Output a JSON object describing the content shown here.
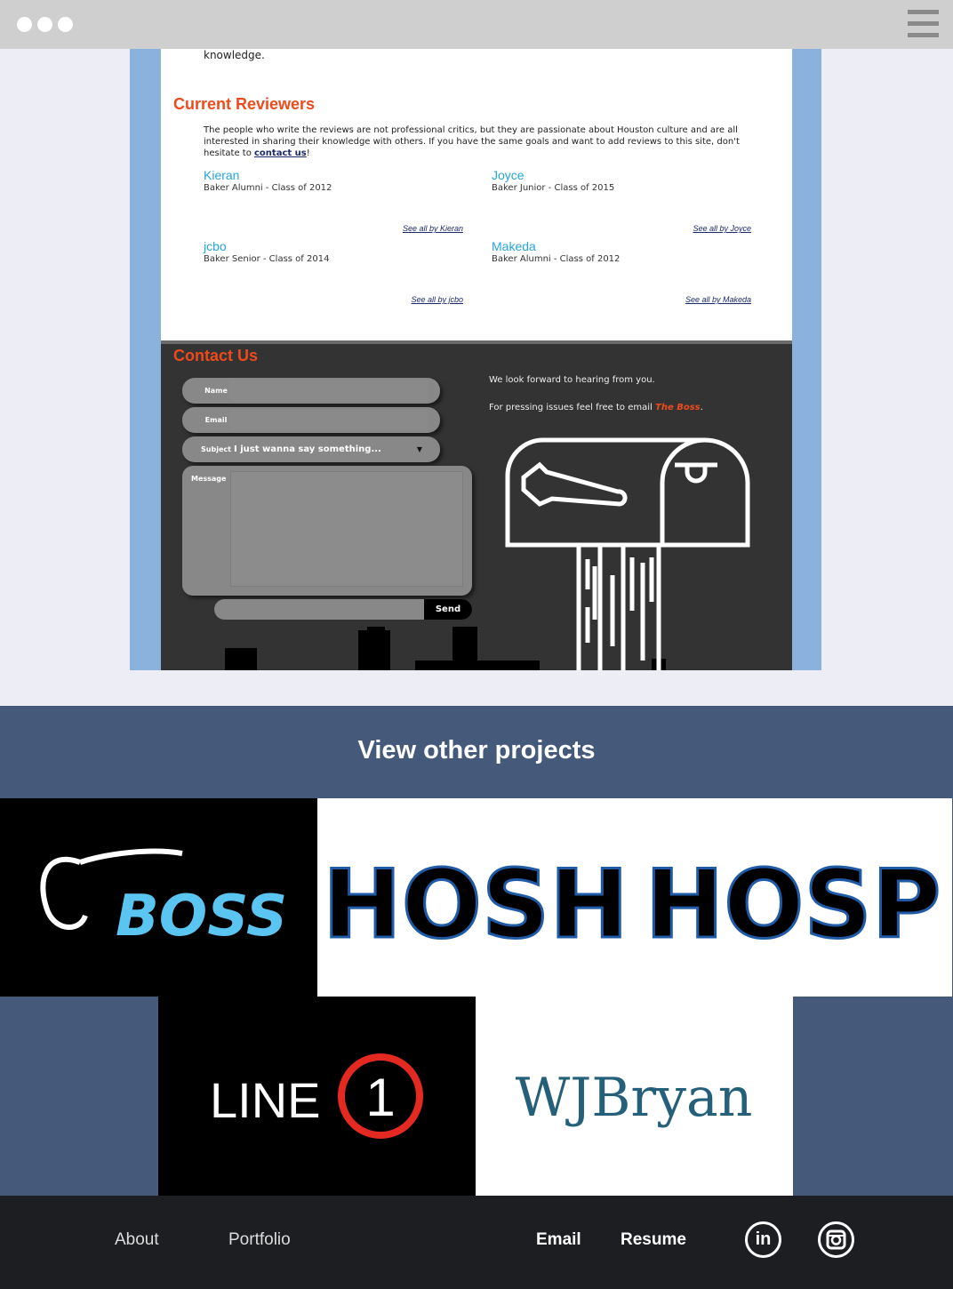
{
  "review_site": {
    "intro_tail": "knowledge.",
    "reviewers_title": "Current Reviewers",
    "reviewers_intro_pre": "The people who write the reviews are not professional critics, but they are passionate about Houston culture and are all interested in sharing their knowledge with others. If you have the same goals and want to add reviews to this site, don't hesitate to ",
    "reviewers_intro_link": "contact us",
    "reviewers_intro_post": "!",
    "reviewers": [
      {
        "name": "Kieran",
        "desc": "Baker Alumni - Class of 2012",
        "link": "See all by Kieran"
      },
      {
        "name": "Joyce",
        "desc": "Baker Junior - Class of 2015",
        "link": "See all by Joyce"
      },
      {
        "name": "jcbo",
        "desc": "Baker Senior - Class of 2014",
        "link": "See all by jcbo"
      },
      {
        "name": "Makeda",
        "desc": "Baker Alumni - Class of 2012",
        "link": "See all by Makeda"
      }
    ],
    "contact": {
      "title": "Contact Us",
      "name_label": "Name",
      "email_label": "Email",
      "subject_label": "Subject",
      "subject_value": "I just wanna say something...",
      "message_label": "Message",
      "send_label": "Send",
      "line1": "We look forward to hearing from you.",
      "line2_pre": "For pressing issues feel free to email ",
      "line2_boss": "The Boss",
      "line2_post": "."
    }
  },
  "projects": {
    "title": "View other projects",
    "tiles": [
      {
        "id": "boss",
        "logo": "BOSS",
        "logo_prefix": "The"
      },
      {
        "id": "hosh",
        "logo": "HOSH"
      },
      {
        "id": "hosp",
        "logo": "HOSP"
      },
      {
        "id": "line1",
        "logo_word": "LINE",
        "logo_num": "1"
      },
      {
        "id": "wjbryan",
        "logo": "WJBryan"
      }
    ]
  },
  "footer": {
    "about": "About",
    "portfolio": "Portfolio",
    "email": "Email",
    "resume": "Resume",
    "linkedin_text": "in",
    "icons": [
      "linkedin-icon",
      "instagram-icon"
    ]
  },
  "colors": {
    "accent_orange": "#ee4a1c",
    "reviewer_blue": "#27a4e0",
    "projects_bg": "#455a7a",
    "footer_bg": "#1c1e22",
    "frame_blue": "#8ab2dc"
  }
}
